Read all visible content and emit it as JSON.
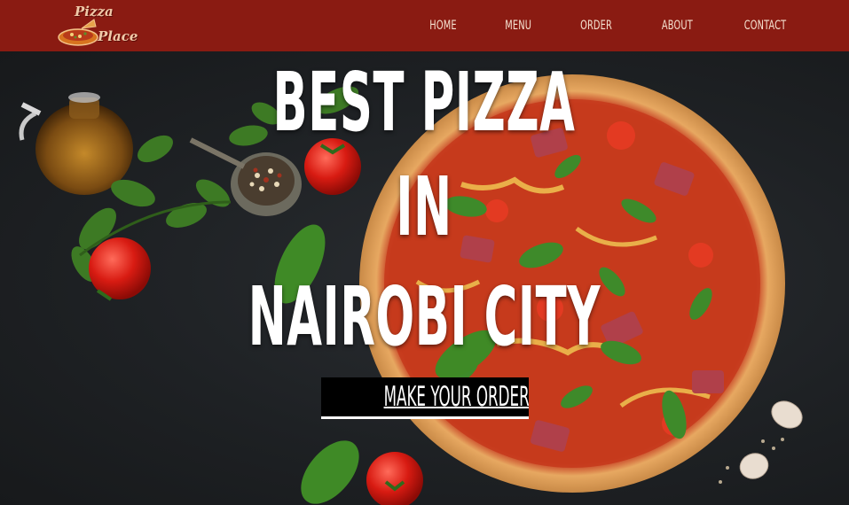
{
  "logo": {
    "line1": "Pizza",
    "line2": "Place"
  },
  "nav": {
    "items": [
      {
        "label": "HOME"
      },
      {
        "label": "MENU"
      },
      {
        "label": "ORDER"
      },
      {
        "label": "ABOUT"
      },
      {
        "label": "CONTACT"
      }
    ]
  },
  "hero": {
    "line1": "BEST PIZZA",
    "line2": "IN",
    "line3": "NAIROBI CITY",
    "cta_label": "MAKE YOUR ORDER NOW"
  },
  "colors": {
    "nav_bg": "#8a1b12",
    "nav_text": "#f6e3d2",
    "hero_bg": "#1e2124",
    "cta_bg": "#000000",
    "headline": "#ffffff"
  }
}
